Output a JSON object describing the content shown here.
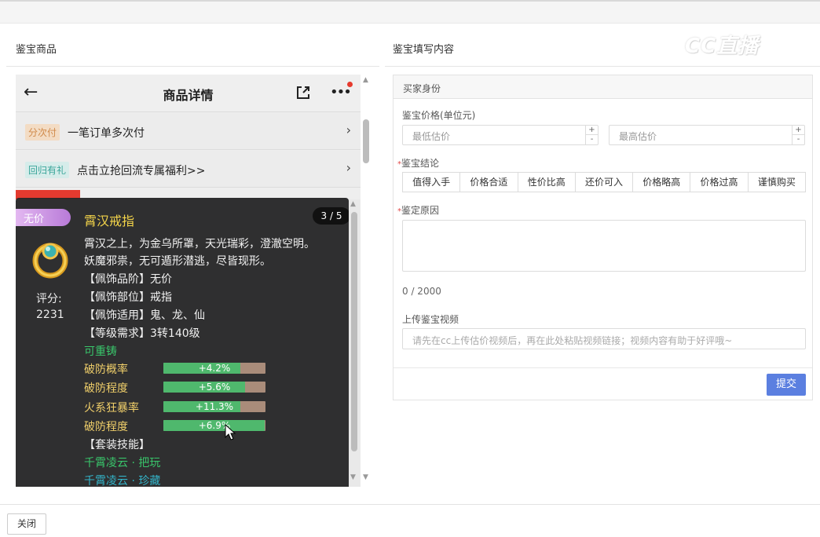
{
  "left_section": {
    "title": "鉴宝商品"
  },
  "right_section": {
    "title": "鉴宝填写内容"
  },
  "watermark": "CC直播",
  "phone": {
    "header_title": "商品详情",
    "rows": [
      {
        "tag": "分次付",
        "text": "一笔订单多次付"
      },
      {
        "tag": "回归有礼",
        "text": "点击立抢回流专属福利>>"
      }
    ]
  },
  "item": {
    "badge": "无价",
    "name": "霄汉戒指",
    "pager": "3 / 5",
    "score_label": "评分:",
    "score_value": "2231",
    "desc": [
      "霄汉之上，为金乌所罩，天光瑞彩，澄澈空明。",
      "妖魔邪祟，无可遁形潜逃，尽皆现形。"
    ],
    "attrs": [
      "【佩饰品阶】无价",
      "【佩饰部位】戒指",
      "【佩饰适用】鬼、龙、仙",
      "【等级需求】3转140级"
    ],
    "reforge": "可重铸",
    "stats": [
      {
        "label": "破防概率",
        "value": "+4.2%",
        "fill": 0.75
      },
      {
        "label": "破防程度",
        "value": "+5.6%",
        "fill": 0.8
      },
      {
        "label": "火系狂暴率",
        "value": "+11.3%",
        "fill": 0.75
      },
      {
        "label": "破防程度",
        "value": "+6.9%",
        "fill": 0.99
      }
    ],
    "set_title": "【套装技能】",
    "set_skills": [
      "千霄凌云 · 把玩",
      "千霄凌云 · 珍藏"
    ]
  },
  "form": {
    "header": "买家身份",
    "price_label": "鉴宝价格(单位元)",
    "min_placeholder": "最低估价",
    "max_placeholder": "最高估价",
    "conclusion_label": "鉴宝结论",
    "conclusions": [
      "值得入手",
      "价格合适",
      "性价比高",
      "还价可入",
      "价格略高",
      "价格过高",
      "谨慎购买"
    ],
    "reason_label": "鉴定原因",
    "counter": "0 / 2000",
    "video_label": "上传鉴宝视频",
    "video_placeholder": "请先在cc上传估价视频后，再在此处粘贴视频链接；视频内容有助于好评哦~",
    "submit": "提交"
  },
  "close": "关闭",
  "colors": {
    "accent": "#5b7fe0",
    "required": "#e24a4a",
    "green_text": "#39c66b"
  }
}
